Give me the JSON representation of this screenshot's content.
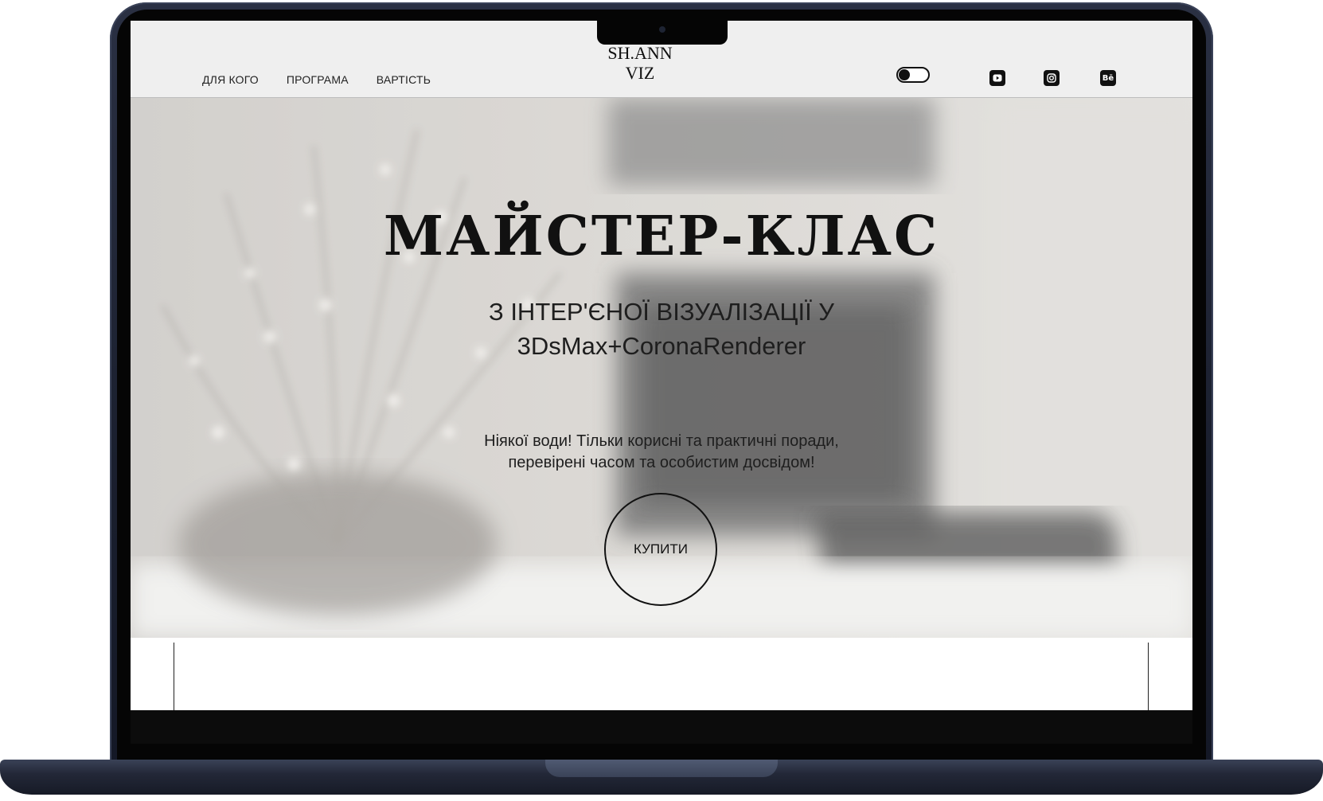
{
  "header": {
    "nav": [
      {
        "label": "ДЛЯ КОГО"
      },
      {
        "label": "ПРОГРАМА"
      },
      {
        "label": "ВАРТІСТЬ"
      }
    ],
    "logo_line1": "SH.ANN",
    "logo_line2": "VIZ",
    "theme_toggle": "theme-toggle",
    "social_icons": [
      "youtube-icon",
      "instagram-icon",
      "behance-icon"
    ],
    "behance_glyph": "Bē"
  },
  "hero": {
    "title": "МАЙСТЕР-КЛАС",
    "subtitle_line1": "З ІНТЕР'ЄНОЇ ВІЗУАЛІЗАЦІЇ У",
    "subtitle_line2": "3DsMax+CoronaRenderer",
    "text_line1": "Ніякої води! Тільки корисні та практичні поради,",
    "text_line2": "перевірені часом та особистим досвідом!",
    "buy_label": "КУПИТИ"
  },
  "colors": {
    "header_bg": "#efefef",
    "text": "#111111",
    "laptop_body": "#1f2435"
  }
}
